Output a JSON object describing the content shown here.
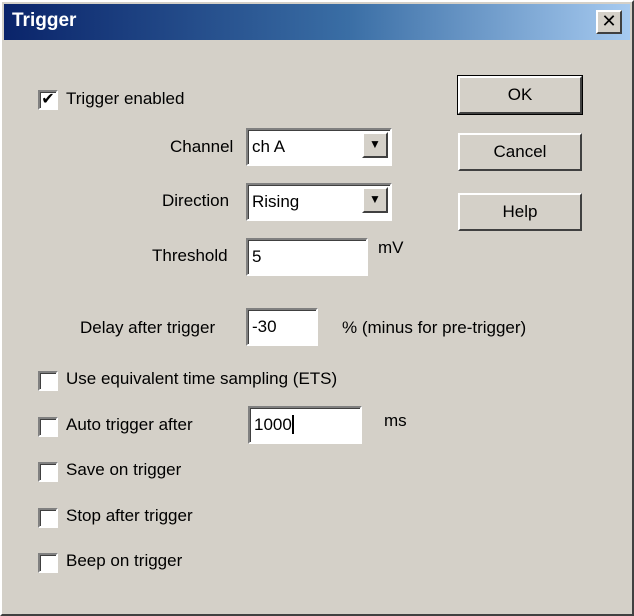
{
  "window": {
    "title": "Trigger",
    "close_glyph": "✕"
  },
  "buttons": {
    "ok": "OK",
    "cancel": "Cancel",
    "help": "Help"
  },
  "trigger_enabled": {
    "label": "Trigger enabled",
    "checked": true
  },
  "channel": {
    "label": "Channel",
    "value": "ch A"
  },
  "direction": {
    "label": "Direction",
    "value": "Rising"
  },
  "threshold": {
    "label": "Threshold",
    "value": "5",
    "unit": "mV"
  },
  "delay": {
    "label": "Delay after trigger",
    "value": "-30",
    "note": "% (minus for pre-trigger)"
  },
  "options": {
    "ets": {
      "label": "Use equivalent time sampling (ETS)",
      "checked": false
    },
    "auto_trigger": {
      "label": "Auto trigger after",
      "checked": false,
      "value": "1000",
      "unit": "ms"
    },
    "save": {
      "label": "Save on trigger",
      "checked": false
    },
    "stop": {
      "label": "Stop after trigger",
      "checked": false
    },
    "beep": {
      "label": "Beep on trigger",
      "checked": false
    }
  },
  "icons": {
    "checkmark": "checkmark-icon",
    "dropdown": "chevron-down-icon",
    "close": "close-icon"
  }
}
